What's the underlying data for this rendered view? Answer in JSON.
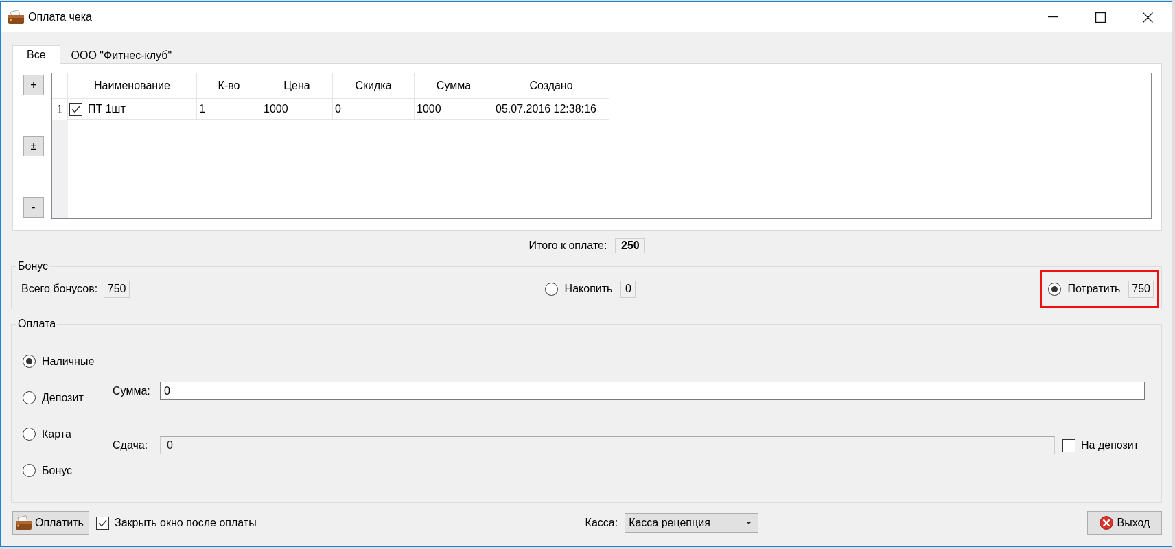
{
  "window": {
    "title": "Оплата чека"
  },
  "tabs": [
    {
      "label": "Все",
      "selected": true
    },
    {
      "label": "ООО \"Фитнес-клуб\"",
      "selected": false
    }
  ],
  "row_buttons": [
    "+",
    "±",
    "-"
  ],
  "table": {
    "columns": [
      "Наименование",
      "К-во",
      "Цена",
      "Скидка",
      "Сумма",
      "Создано"
    ],
    "rows": [
      {
        "number": "1",
        "checked": true,
        "cells": [
          "ПТ 1шт",
          "1",
          "1000",
          "0",
          "1000",
          "05.07.2016 12:38:16"
        ]
      }
    ]
  },
  "total": {
    "label": "Итого к оплате:",
    "value": "250"
  },
  "bonus": {
    "title": "Бонус",
    "total_label": "Всего бонусов:",
    "total_value": "750",
    "options": [
      {
        "label": "Накопить",
        "value": "0",
        "selected": false,
        "highlighted": false
      },
      {
        "label": "Потратить",
        "value": "750",
        "selected": true,
        "highlighted": true
      }
    ]
  },
  "payment": {
    "title": "Оплата",
    "methods": [
      {
        "label": "Наличные",
        "selected": true
      },
      {
        "label": "Депозит",
        "selected": false
      },
      {
        "label": "Карта",
        "selected": false
      },
      {
        "label": "Бонус",
        "selected": false
      }
    ],
    "amount": {
      "label": "Сумма:",
      "value": "0"
    },
    "change": {
      "label": "Сдача:",
      "value": "0",
      "disabled": true
    },
    "to_deposit": {
      "label": "На депозит",
      "checked": false
    }
  },
  "footer": {
    "pay_button": "Оплатить",
    "close_after": {
      "label": "Закрыть окно после оплаты",
      "checked": true
    },
    "register": {
      "label": "Касса:",
      "value": "Касса рецепция"
    },
    "exit_button": "Выход"
  }
}
